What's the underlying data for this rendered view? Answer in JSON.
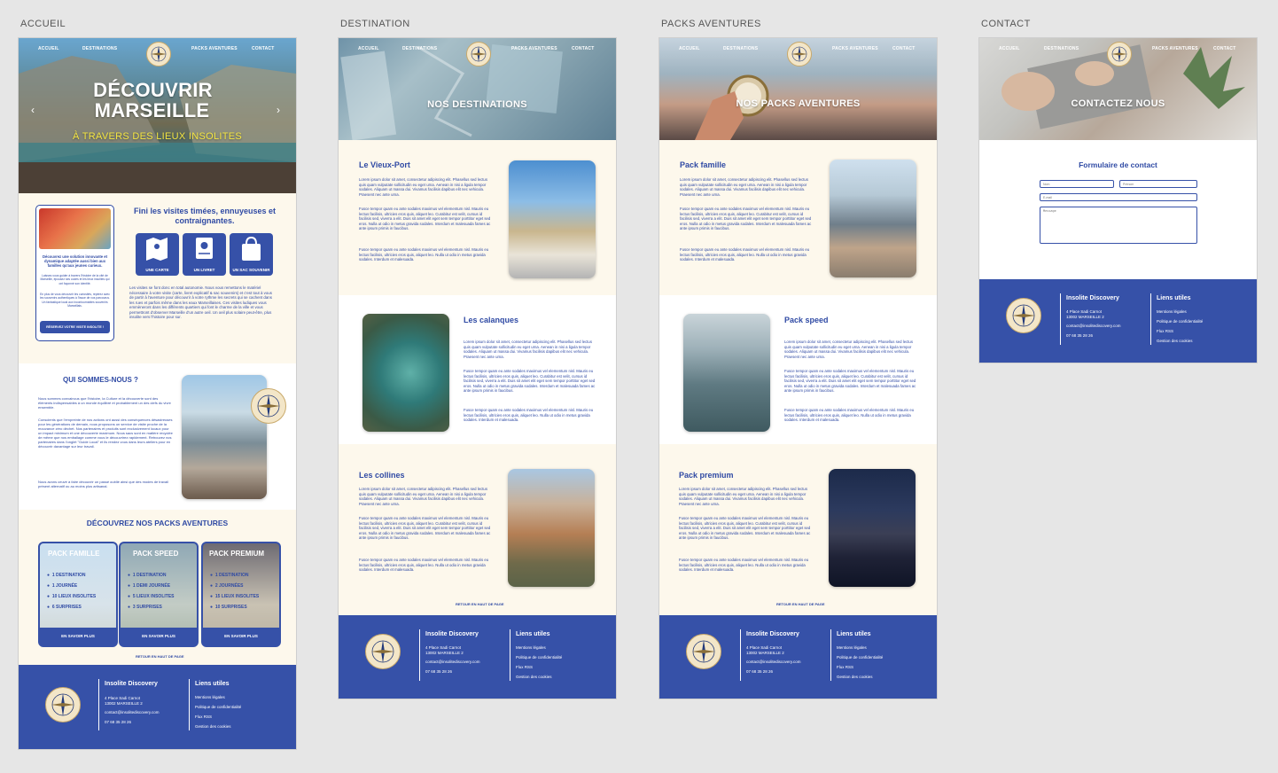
{
  "artboards": {
    "accueil": "ACCUEIL",
    "destination": "DESTINATION",
    "packs": "PACKS AVENTURES",
    "contact": "CONTACT"
  },
  "nav": {
    "accueil": "ACCUEIL",
    "destinations": "DESTINATIONS",
    "packs": "PACKS AVENTURES",
    "contact": "CONTACT"
  },
  "home": {
    "hero_line1": "DÉCOUVRIR",
    "hero_line2": "MARSEILLE",
    "hero_sub": "À TRAVERS DES LIEUX INSOLITES",
    "intro_title": "Fini les visites timées, ennuyeuses et contraignantes.",
    "card_head": "Découvrez une solution innovante et dynamique adaptée aussi bien aux familles qu'aux jeunes curieux.",
    "card_text1": "Laissez-vous guider à travers l'histoire de la cité de Marseille, épousez ses codes et les lieux insolites qui ont façonné son identité.",
    "card_text2": "En plus de vous découvrir les curiosités, repérez avec les souvenirs authentiques à l'issue de vos parcourus. Un fantastique local aux incontournables souvenirs Marseillais.",
    "card_button": "RÉSERVEZ VOTRE VISITE INSOLITE !",
    "icons": [
      "UNE CARTE",
      "UN LIVRET",
      "UN SAC SOUVENIR"
    ],
    "intro_para": "Les visites se font donc en total autonomie. Nous vous remettons le matériel nécessaire à votre visite (carte, livret explicatif & sac souvenirs) et c'est tout à vous de partir à l'aventure pour découvrir à votre rythme les secrets qui se cachent dans les rues et parfois même dans les eaux Marseillaises. Ces visites ludiques vous emmèneront dans les différents quartiers qui font le charme de la ville et vous permettront d'observer Marseille d'un autre oeil. Un oeil plus solaire peut-être, plus insolite vers l'histoire pour sur.",
    "about_title": "QUI SOMMES-NOUS ?",
    "about_p1": "Nous sommes convaincus que l'histoire, la Culture et la découverte sont des éléments indispensables à un monde équilibré et probablement un des clefs du vivre ensemble.",
    "about_p2": "Conscients que l'empreinte de nos actions ont aussi des conséquences désastreuses pour les générations de demain, nous proposons un service de visite proche de la mouvance zéro déchet. Nos partenaires et produits sont exclusivement locaux pour un impact minimum et une découverte maximum. Nous sacs sont en matière recyclée de même que nos emballage comme vous le découvrirez rapidement. Retrouvez nos partenaires dans l'onglet \"Guide Local\" et ils rendez vous dans leurs ateliers pour en découvrir davantage sur leur travail.",
    "about_p3": "Nous avons ceuvé à faire découvrir un passé oublié ainsi que des modes de travail présent alternatif ou au moins plus artisanal.",
    "packs_title": "DÉCOUVREZ NOS PACKS AVENTURES",
    "packs": [
      {
        "name": "PACK FAMILLE",
        "items": [
          "1 DESTINATION",
          "1 JOURNÉE",
          "10 LIEUX INSOLITES",
          "6 SURPRISES"
        ],
        "button": "EN SAVOIR PLUS"
      },
      {
        "name": "PACK SPEED",
        "items": [
          "1 DESTINATION",
          "1 DEMI JOURNÉE",
          "5 LIEUX INSOLITES",
          "3 SURPRISES"
        ],
        "button": "EN SAVOIR PLUS"
      },
      {
        "name": "PACK PREMIUM",
        "items": [
          "1 DESTINATION",
          "2 JOURNÉES",
          "15 LIEUX INSOLITES",
          "10 SURPRISES"
        ],
        "button": "EN SAVOIR PLUS"
      }
    ],
    "back_top": "RETOUR EN HAUT DE PAGE"
  },
  "destination": {
    "hero": "NOS DESTINATIONS",
    "items": [
      "Le Vieux-Port",
      "Les calanques",
      "Les collines"
    ],
    "back_top": "RETOUR EN HAUT DE PAGE"
  },
  "packs_page": {
    "hero": "NOS PACKS AVENTURES",
    "items": [
      "Pack famille",
      "Pack speed",
      "Pack premium"
    ],
    "back_top": "RETOUR EN HAUT DE PAGE"
  },
  "lorem": {
    "p1": "Lorem ipsum dolor sit amet, consectetur adipiscing elit. Phasellus sed lectus quis quam vulputate sollicitudin eu eget urna. Aenean in nisi a ligula tempor sodales. Aliquam ut massa dui. Vivamus facilisis dapibus elit nec vehicula. Praesent nec ante urna.",
    "p2": "Fusce tempor quam eu ante sodales maximus vel elementum nisl. Mauris eu lectus facilisis, ultricies eros quis, aliquet leo. Curabitur est velit, cursus id facilisis sed, viverra a elit. Duis sit amet elit eget sem tempor porttitor eget sed eros. Nulla ut odio in metus gravida sodales. Interdum et malesuada fames ac ante ipsum primis in faucibus.",
    "p3": "Fusce tempor quam eu ante sodales maximus vel elementum nisl. Mauris eu lectus facilisis, ultricies eros quis, aliquet leo. Nulla ut odio in metus gravida sodales. Interdum et malesuada."
  },
  "contact": {
    "hero": "CONTACTEZ NOUS",
    "form_title": "Formulaire de contact",
    "nom": "Nom",
    "prenom": "Prénom",
    "email": "E-mail",
    "message": "Message"
  },
  "footer": {
    "company": "Insolite Discovery",
    "address1": "4 Place Sadi Carnot",
    "address2": "13002 MARSEILLE 2",
    "email": "contact@insolitediscovery.com",
    "phone": "07 68 35 28 26",
    "links_title": "Liens utiles",
    "links": [
      "Mentions légales",
      "Politique de confidentialité",
      "Flux RSS",
      "Gestion des cookies"
    ]
  },
  "colors": {
    "brand_blue": "#3651a8",
    "text_blue": "#2f4aa4",
    "cream": "#fdf8ec",
    "accent_yellow": "#f5e642"
  }
}
